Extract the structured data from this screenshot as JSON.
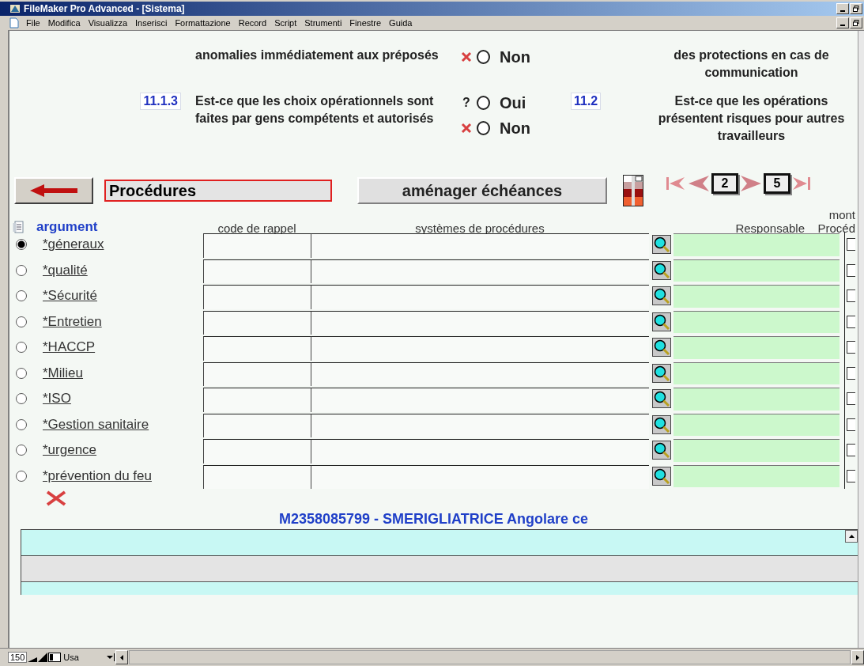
{
  "window": {
    "title": "FileMaker Pro Advanced - [Sistema]"
  },
  "menu": [
    "File",
    "Modifica",
    "Visualizza",
    "Inserisci",
    "Formattazione",
    "Record",
    "Script",
    "Strumenti",
    "Finestre",
    "Guida"
  ],
  "left_questions": [
    {
      "text": "anomalies immédiatement aux préposés",
      "options": [
        {
          "kind": "cross",
          "label": "Non",
          "selected": false
        }
      ]
    },
    {
      "number": "11.1.3",
      "text": "Est-ce que les choix opérationnels sont faites par gens compétents et autorisés",
      "options": [
        {
          "kind": "question",
          "marker": "?",
          "label": "Oui",
          "selected": false
        },
        {
          "kind": "cross",
          "label": "Non",
          "selected": false
        }
      ]
    }
  ],
  "right_questions": [
    {
      "text": "des protections en cas de communication"
    },
    {
      "number": "11.2",
      "text": "Est-ce que les opérations présentent risques pour autres travailleurs"
    }
  ],
  "toolbar": {
    "section_field": "Procédures",
    "schedule_button": "aménager échéances",
    "record": "2",
    "total": "5"
  },
  "table": {
    "columns": [
      "argument",
      "code de rappel",
      "systèmes de procédures",
      "Responsable"
    ],
    "column_5_lines": [
      "mont",
      "Procéd"
    ],
    "rows": [
      {
        "label": "*géneraux",
        "selected": true,
        "checked": false
      },
      {
        "label": "*qualité",
        "selected": false,
        "checked": false
      },
      {
        "label": "*Sécurité",
        "selected": false,
        "checked": false
      },
      {
        "label": "*Entretien",
        "selected": false,
        "checked": false
      },
      {
        "label": "*HACCP",
        "selected": false,
        "checked": false
      },
      {
        "label": "*Milieu",
        "selected": false,
        "checked": false
      },
      {
        "label": "*ISO",
        "selected": false,
        "checked": false
      },
      {
        "label": "*Gestion sanitaire",
        "selected": false,
        "checked": false
      },
      {
        "label": "*urgence",
        "selected": false,
        "checked": false
      },
      {
        "label": "*prévention du feu",
        "selected": false,
        "checked": false
      }
    ]
  },
  "portal": {
    "title": "M2358085799 - SMERIGLIATRICE Angolare ce"
  },
  "status_bar": {
    "zoom": "150",
    "mode": "Usa"
  }
}
